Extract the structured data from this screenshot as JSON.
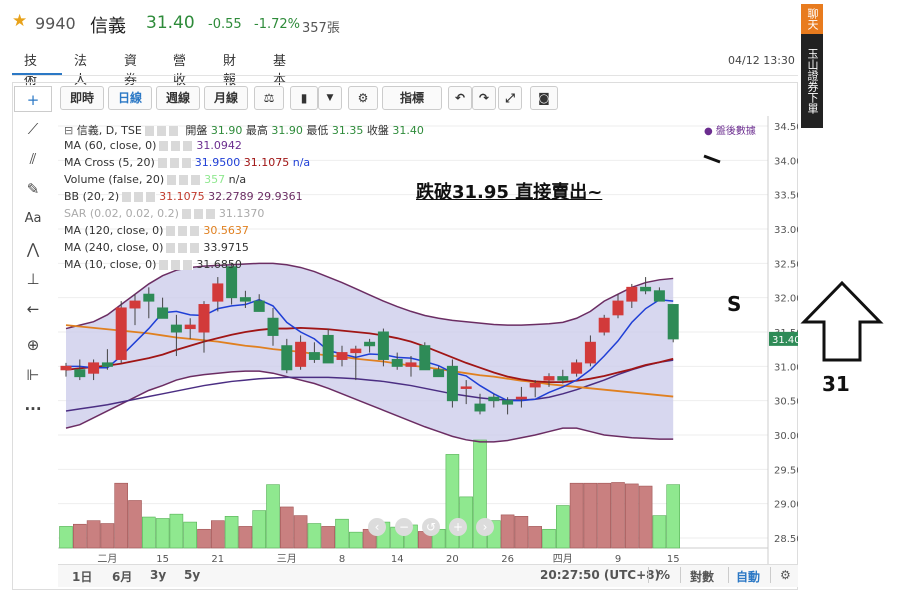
{
  "stock": {
    "star": "★",
    "code": "9940",
    "name": "信義",
    "price": "31.40",
    "change": "-0.55",
    "change_pct": "-1.72%",
    "volume": "357張"
  },
  "tabs": [
    "技術",
    "法人",
    "資券",
    "營收",
    "財報",
    "基本"
  ],
  "datetime": "04/12 13:30",
  "sidebar": {
    "top": "聊天室",
    "bottom": "玉山證券下單"
  },
  "toolbar": {
    "buttons": [
      "即時",
      "日線",
      "週線",
      "月線",
      "⚖",
      "",
      "",
      "⚙",
      "指標",
      "",
      "",
      "",
      ""
    ]
  },
  "legend": {
    "main": {
      "title": "信義, D, TSE",
      "open_label": "開盤",
      "open": "31.90",
      "high_label": "最高",
      "high": "31.90",
      "low_label": "最低",
      "low": "31.35",
      "close_label": "收盤",
      "close": "31.40"
    },
    "rows": [
      {
        "name": "MA (60, close, 0)",
        "values": [
          "31.0942"
        ]
      },
      {
        "name": "MA Cross (5, 20)",
        "values": [
          "31.9500",
          "31.1075",
          "n/a"
        ]
      },
      {
        "name": "Volume (false, 20)",
        "values": [
          "357",
          "n/a"
        ]
      },
      {
        "name": "BB (20, 2)",
        "values": [
          "31.1075",
          "32.2789",
          "29.9361"
        ]
      },
      {
        "name": "SAR (0.02, 0.02, 0.2)",
        "values": [
          "31.1370"
        ]
      },
      {
        "name": "MA (120, close, 0)",
        "values": [
          "30.5637"
        ]
      },
      {
        "name": "MA (240, close, 0)",
        "values": [
          "33.9715"
        ]
      },
      {
        "name": "MA (10, close, 0)",
        "values": [
          "31.6850"
        ]
      }
    ],
    "after_hours": "盤後數據"
  },
  "annotation": {
    "text": "跌破31.95 直接賣出~",
    "s": "S",
    "arrow_label": "31"
  },
  "bottom": {
    "ranges": [
      "1日",
      "6月",
      "3y",
      "5y"
    ],
    "time": "20:27:50 (UTC+8)",
    "pct": "%",
    "log": "對數",
    "auto": "自動"
  },
  "colors": {
    "up": "#d23a3a",
    "down": "#2e8b57",
    "vol_up": "#c98080",
    "vol_down": "#8fe88f",
    "ma5": "#1f3fd6",
    "ma20": "#a01515",
    "ma120": "#e08020",
    "bb": "#6b2d63",
    "band": "#c9c9ea"
  },
  "chart_data": {
    "type": "candlestick",
    "price_axis": {
      "min": 28.5,
      "max": 34.5,
      "ticks": [
        "34.50",
        "34.00",
        "33.50",
        "33.00",
        "32.50",
        "32.00",
        "31.50",
        "31.00",
        "30.50",
        "30.00",
        "29.50",
        "29.00",
        "28.50"
      ],
      "last": "31.40"
    },
    "x_ticks": [
      {
        "label": "二月",
        "index": 3
      },
      {
        "label": "15",
        "index": 7
      },
      {
        "label": "21",
        "index": 11
      },
      {
        "label": "三月",
        "index": 16
      },
      {
        "label": "8",
        "index": 20
      },
      {
        "label": "14",
        "index": 24
      },
      {
        "label": "20",
        "index": 28
      },
      {
        "label": "26",
        "index": 32
      },
      {
        "label": "四月",
        "index": 36
      },
      {
        "label": "9",
        "index": 40
      },
      {
        "label": "15",
        "index": 44
      }
    ],
    "candles": [
      {
        "o": 30.95,
        "h": 31.05,
        "l": 30.85,
        "c": 31.0
      },
      {
        "o": 30.95,
        "h": 31.1,
        "l": 30.8,
        "c": 30.85
      },
      {
        "o": 30.9,
        "h": 31.1,
        "l": 30.8,
        "c": 31.05
      },
      {
        "o": 31.05,
        "h": 31.25,
        "l": 30.95,
        "c": 31.0
      },
      {
        "o": 31.1,
        "h": 31.95,
        "l": 31.05,
        "c": 31.85
      },
      {
        "o": 31.85,
        "h": 32.05,
        "l": 31.6,
        "c": 31.95
      },
      {
        "o": 32.05,
        "h": 32.15,
        "l": 31.7,
        "c": 31.95
      },
      {
        "o": 31.85,
        "h": 32.0,
        "l": 31.7,
        "c": 31.7
      },
      {
        "o": 31.6,
        "h": 31.75,
        "l": 31.15,
        "c": 31.5
      },
      {
        "o": 31.55,
        "h": 31.7,
        "l": 31.4,
        "c": 31.6
      },
      {
        "o": 31.5,
        "h": 31.95,
        "l": 31.2,
        "c": 31.9
      },
      {
        "o": 31.95,
        "h": 32.3,
        "l": 31.8,
        "c": 32.2
      },
      {
        "o": 32.45,
        "h": 32.5,
        "l": 31.9,
        "c": 32.0
      },
      {
        "o": 32.0,
        "h": 32.1,
        "l": 31.85,
        "c": 31.95
      },
      {
        "o": 31.95,
        "h": 32.05,
        "l": 31.8,
        "c": 31.8
      },
      {
        "o": 31.7,
        "h": 31.85,
        "l": 31.3,
        "c": 31.45
      },
      {
        "o": 31.3,
        "h": 31.4,
        "l": 30.9,
        "c": 30.95
      },
      {
        "o": 31.0,
        "h": 31.45,
        "l": 30.95,
        "c": 31.35
      },
      {
        "o": 31.2,
        "h": 31.35,
        "l": 31.05,
        "c": 31.1
      },
      {
        "o": 31.45,
        "h": 31.55,
        "l": 31.05,
        "c": 31.05
      },
      {
        "o": 31.1,
        "h": 31.3,
        "l": 31.0,
        "c": 31.2
      },
      {
        "o": 31.2,
        "h": 31.3,
        "l": 30.8,
        "c": 31.25
      },
      {
        "o": 31.35,
        "h": 31.4,
        "l": 31.2,
        "c": 31.3
      },
      {
        "o": 31.5,
        "h": 31.55,
        "l": 31.0,
        "c": 31.1
      },
      {
        "o": 31.1,
        "h": 31.2,
        "l": 30.95,
        "c": 31.0
      },
      {
        "o": 31.0,
        "h": 31.15,
        "l": 30.85,
        "c": 31.05
      },
      {
        "o": 31.3,
        "h": 31.35,
        "l": 30.95,
        "c": 30.95
      },
      {
        "o": 30.95,
        "h": 31.0,
        "l": 30.85,
        "c": 30.85
      },
      {
        "o": 31.0,
        "h": 31.1,
        "l": 30.4,
        "c": 30.5
      },
      {
        "o": 30.7,
        "h": 30.8,
        "l": 30.45,
        "c": 30.7
      },
      {
        "o": 30.45,
        "h": 30.6,
        "l": 30.3,
        "c": 30.35
      },
      {
        "o": 30.55,
        "h": 30.6,
        "l": 30.4,
        "c": 30.5
      },
      {
        "o": 30.5,
        "h": 30.55,
        "l": 30.3,
        "c": 30.45
      },
      {
        "o": 30.55,
        "h": 30.7,
        "l": 30.4,
        "c": 30.55
      },
      {
        "o": 30.7,
        "h": 30.8,
        "l": 30.55,
        "c": 30.75
      },
      {
        "o": 30.8,
        "h": 30.9,
        "l": 30.7,
        "c": 30.85
      },
      {
        "o": 30.85,
        "h": 30.95,
        "l": 30.75,
        "c": 30.8
      },
      {
        "o": 30.9,
        "h": 31.1,
        "l": 30.85,
        "c": 31.05
      },
      {
        "o": 31.05,
        "h": 31.45,
        "l": 31.0,
        "c": 31.35
      },
      {
        "o": 31.5,
        "h": 31.75,
        "l": 31.45,
        "c": 31.7
      },
      {
        "o": 31.75,
        "h": 32.05,
        "l": 31.7,
        "c": 31.95
      },
      {
        "o": 31.95,
        "h": 32.2,
        "l": 31.85,
        "c": 32.15
      },
      {
        "o": 32.15,
        "h": 32.3,
        "l": 32.05,
        "c": 32.1
      },
      {
        "o": 32.1,
        "h": 32.15,
        "l": 31.95,
        "c": 31.95
      },
      {
        "o": 31.9,
        "h": 31.9,
        "l": 31.35,
        "c": 31.4
      }
    ],
    "volume": [
      {
        "v": 300,
        "up": false
      },
      {
        "v": 330,
        "up": true
      },
      {
        "v": 380,
        "up": true
      },
      {
        "v": 340,
        "up": true
      },
      {
        "v": 900,
        "up": true
      },
      {
        "v": 660,
        "up": true
      },
      {
        "v": 430,
        "up": false
      },
      {
        "v": 410,
        "up": false
      },
      {
        "v": 470,
        "up": false
      },
      {
        "v": 360,
        "up": false
      },
      {
        "v": 260,
        "up": true
      },
      {
        "v": 380,
        "up": true
      },
      {
        "v": 440,
        "up": false
      },
      {
        "v": 300,
        "up": true
      },
      {
        "v": 520,
        "up": false
      },
      {
        "v": 880,
        "up": false
      },
      {
        "v": 570,
        "up": true
      },
      {
        "v": 450,
        "up": true
      },
      {
        "v": 340,
        "up": false
      },
      {
        "v": 300,
        "up": true
      },
      {
        "v": 400,
        "up": false
      },
      {
        "v": 220,
        "up": false
      },
      {
        "v": 260,
        "up": true
      },
      {
        "v": 360,
        "up": false
      },
      {
        "v": 290,
        "up": false
      },
      {
        "v": 320,
        "up": false
      },
      {
        "v": 230,
        "up": true
      },
      {
        "v": 260,
        "up": false
      },
      {
        "v": 1300,
        "up": false
      },
      {
        "v": 710,
        "up": false
      },
      {
        "v": 1500,
        "up": false
      },
      {
        "v": 380,
        "up": false
      },
      {
        "v": 460,
        "up": true
      },
      {
        "v": 440,
        "up": true
      },
      {
        "v": 300,
        "up": true
      },
      {
        "v": 260,
        "up": false
      },
      {
        "v": 590,
        "up": false
      },
      {
        "v": 900,
        "up": true
      },
      {
        "v": 900,
        "up": true
      },
      {
        "v": 900,
        "up": true
      },
      {
        "v": 910,
        "up": true
      },
      {
        "v": 890,
        "up": true
      },
      {
        "v": 860,
        "up": true
      },
      {
        "v": 450,
        "up": false
      },
      {
        "v": 880,
        "up": false
      }
    ],
    "volume_max": 1500,
    "series": {
      "ma5": [
        31.0,
        31.0,
        30.98,
        30.98,
        31.15,
        31.35,
        31.55,
        31.78,
        31.8,
        31.75,
        31.74,
        31.84,
        31.88,
        31.9,
        31.97,
        31.88,
        31.64,
        31.5,
        31.4,
        31.23,
        31.18,
        31.13,
        31.18,
        31.17,
        31.13,
        31.12,
        31.07,
        31.01,
        30.91,
        30.86,
        30.72,
        30.6,
        30.5,
        30.5,
        30.52,
        30.62,
        30.7,
        30.8,
        30.95,
        31.15,
        31.37,
        31.64,
        31.84,
        31.97,
        31.95
      ],
      "ma20": [
        30.95,
        30.97,
        30.99,
        31.01,
        31.04,
        31.08,
        31.12,
        31.17,
        31.24,
        31.3,
        31.36,
        31.41,
        31.46,
        31.5,
        31.53,
        31.55,
        31.55,
        31.56,
        31.55,
        31.54,
        31.52,
        31.5,
        31.48,
        31.45,
        31.41,
        31.36,
        31.29,
        31.21,
        31.13,
        31.05,
        30.98,
        30.91,
        30.85,
        30.81,
        30.78,
        30.77,
        30.77,
        30.79,
        30.82,
        30.86,
        30.91,
        30.96,
        31.02,
        31.06,
        31.11
      ],
      "ma120": [
        31.6,
        31.58,
        31.56,
        31.54,
        31.52,
        31.5,
        31.48,
        31.45,
        31.42,
        31.4,
        31.38,
        31.36,
        31.33,
        31.3,
        31.28,
        31.25,
        31.23,
        31.21,
        31.18,
        31.16,
        31.14,
        31.11,
        31.09,
        31.07,
        31.04,
        31.01,
        30.99,
        30.96,
        30.93,
        30.9,
        30.87,
        30.85,
        30.82,
        30.79,
        30.77,
        30.74,
        30.72,
        30.7,
        30.68,
        30.66,
        30.64,
        30.62,
        30.6,
        30.58,
        30.56
      ],
      "ma60": [
        30.35,
        30.38,
        30.41,
        30.44,
        30.48,
        30.52,
        30.56,
        30.6,
        30.64,
        30.68,
        30.72,
        30.75,
        30.78,
        30.8,
        30.82,
        30.83,
        30.84,
        30.84,
        30.84,
        30.84,
        30.83,
        30.82,
        30.8,
        30.78,
        30.75,
        30.72,
        30.68,
        30.64,
        30.6,
        30.57,
        30.54,
        30.52,
        30.51,
        30.51,
        30.52,
        30.55,
        30.6,
        30.66,
        30.73,
        30.8,
        30.88,
        30.95,
        31.01,
        31.06,
        31.09
      ],
      "bb_upper": [
        31.55,
        31.6,
        31.65,
        31.75,
        31.9,
        32.05,
        32.2,
        32.32,
        32.4,
        32.44,
        32.46,
        32.47,
        32.48,
        32.49,
        32.5,
        32.5,
        32.48,
        32.44,
        32.38,
        32.3,
        32.22,
        32.13,
        32.04,
        31.95,
        31.87,
        31.8,
        31.74,
        31.7,
        31.67,
        31.65,
        31.63,
        31.61,
        31.6,
        31.6,
        31.61,
        31.62,
        31.64,
        31.7,
        31.8,
        31.95,
        32.05,
        32.15,
        32.22,
        32.26,
        32.28
      ],
      "bb_lower": [
        30.1,
        30.15,
        30.25,
        30.35,
        30.45,
        30.55,
        30.65,
        30.72,
        30.8,
        30.85,
        30.88,
        30.9,
        30.92,
        30.93,
        30.93,
        30.9,
        30.85,
        30.8,
        30.75,
        30.68,
        30.6,
        30.52,
        30.44,
        30.36,
        30.28,
        30.2,
        30.12,
        30.05,
        29.98,
        29.93,
        29.9,
        29.9,
        29.92,
        29.96,
        30.0,
        30.05,
        30.1,
        30.1,
        30.05,
        30.0,
        29.98,
        29.96,
        29.95,
        29.94,
        29.94
      ]
    }
  }
}
